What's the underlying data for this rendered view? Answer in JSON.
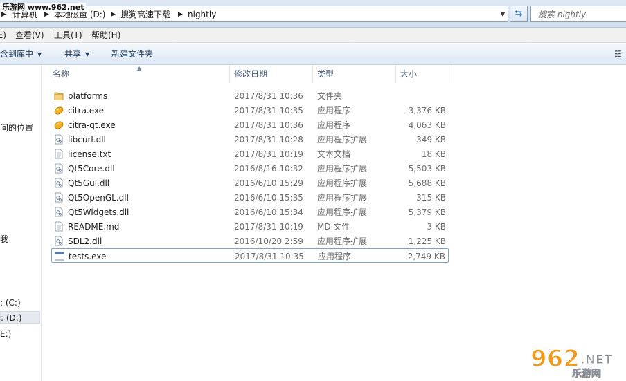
{
  "address_bar": {
    "crumbs": [
      "计算机",
      "本地磁盘 (D:)",
      "搜狗高速下载",
      "nightly"
    ],
    "search_placeholder": "搜索 nightly"
  },
  "menu": {
    "items": [
      "(E)",
      "查看(V)",
      "工具(T)",
      "帮助(H)"
    ]
  },
  "toolbar": {
    "include_library_label": "含到库中",
    "share_label": "共享",
    "new_folder_label": "新建文件夹"
  },
  "nav": {
    "items": [
      "间的位置",
      "我",
      ": (C:)",
      ": (D:)",
      "E:)"
    ]
  },
  "columns": {
    "name": "名称",
    "date": "修改日期",
    "type": "类型",
    "size": "大小"
  },
  "files": [
    {
      "name": "platforms",
      "date": "2017/8/31 10:36",
      "type": "文件夹",
      "size": "",
      "icon": "folder-icon"
    },
    {
      "name": "citra.exe",
      "date": "2017/8/31 10:35",
      "type": "应用程序",
      "size": "3,376 KB",
      "icon": "citra-app-icon"
    },
    {
      "name": "citra-qt.exe",
      "date": "2017/8/31 10:36",
      "type": "应用程序",
      "size": "4,063 KB",
      "icon": "citra-app-icon"
    },
    {
      "name": "libcurl.dll",
      "date": "2017/8/31 10:28",
      "type": "应用程序扩展",
      "size": "349 KB",
      "icon": "dll-icon"
    },
    {
      "name": "license.txt",
      "date": "2017/8/31 10:19",
      "type": "文本文档",
      "size": "18 KB",
      "icon": "text-file-icon"
    },
    {
      "name": "Qt5Core.dll",
      "date": "2016/8/16 10:32",
      "type": "应用程序扩展",
      "size": "5,503 KB",
      "icon": "dll-icon"
    },
    {
      "name": "Qt5Gui.dll",
      "date": "2016/6/10 15:29",
      "type": "应用程序扩展",
      "size": "5,688 KB",
      "icon": "dll-icon"
    },
    {
      "name": "Qt5OpenGL.dll",
      "date": "2016/6/10 15:35",
      "type": "应用程序扩展",
      "size": "315 KB",
      "icon": "dll-icon"
    },
    {
      "name": "Qt5Widgets.dll",
      "date": "2016/6/10 15:34",
      "type": "应用程序扩展",
      "size": "5,379 KB",
      "icon": "dll-icon"
    },
    {
      "name": "README.md",
      "date": "2017/8/31 10:19",
      "type": "MD 文件",
      "size": "3 KB",
      "icon": "text-file-icon"
    },
    {
      "name": "SDL2.dll",
      "date": "2016/10/20 2:59",
      "type": "应用程序扩展",
      "size": "1,225 KB",
      "icon": "dll-icon"
    },
    {
      "name": "tests.exe",
      "date": "2017/8/31 10:35",
      "type": "应用程序",
      "size": "2,749 KB",
      "icon": "exe-window-icon"
    }
  ],
  "selected_index": 11,
  "watermark": {
    "top_text": "乐游网 www.962.net",
    "logo_number": "962",
    "logo_suffix": ".NET",
    "logo_cn": "乐游网"
  },
  "colors": {
    "accent": "#2a6cb0",
    "selection_border": "#7da2ce",
    "folder": "#e8c25a",
    "citra": "#f2b01e",
    "logo_orange": "#f39a1a"
  }
}
